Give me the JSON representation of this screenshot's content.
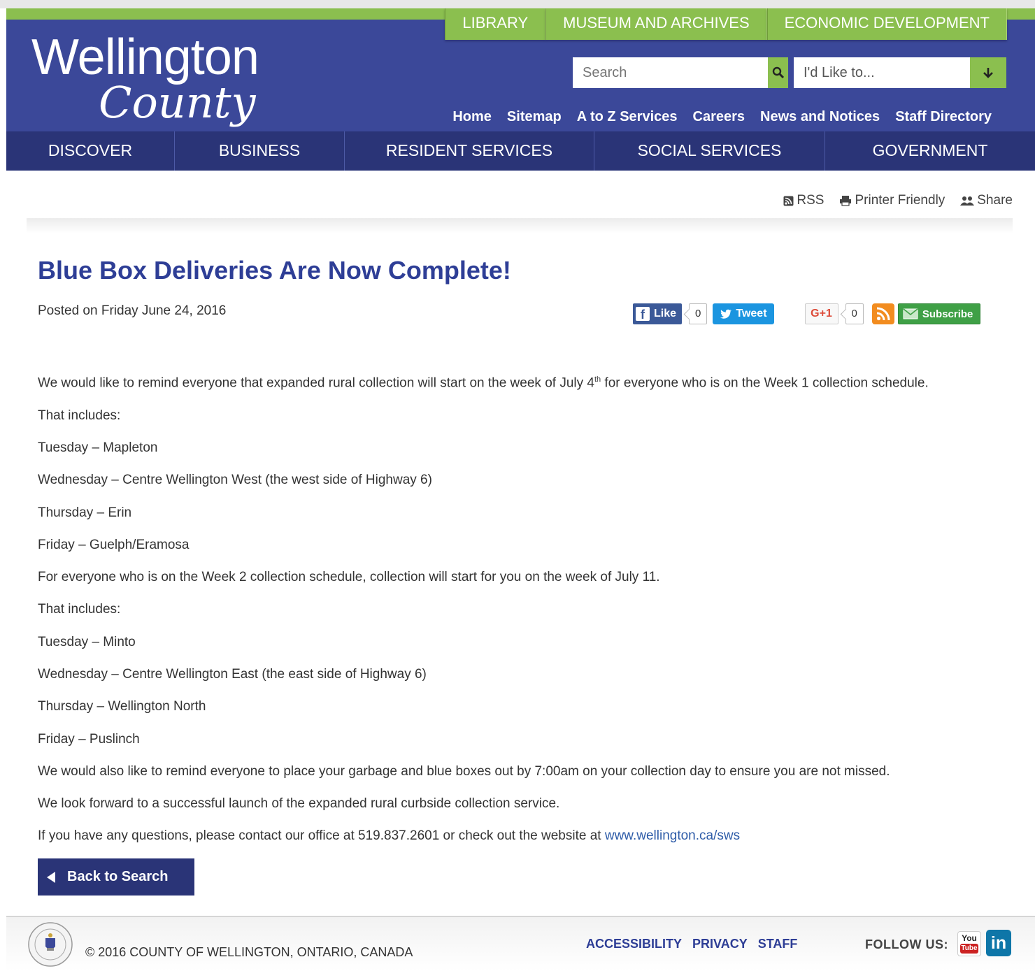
{
  "header": {
    "logo_line1": "Wellington",
    "logo_line2": "County",
    "green_tabs": [
      "LIBRARY",
      "MUSEUM AND ARCHIVES",
      "ECONOMIC DEVELOPMENT"
    ],
    "search_placeholder": "Search",
    "like_to": "I'd Like to...",
    "util_nav": [
      "Home",
      "Sitemap",
      "A to Z Services",
      "Careers",
      "News and Notices",
      "Staff Directory"
    ],
    "main_nav": [
      "DISCOVER",
      "BUSINESS",
      "RESIDENT SERVICES",
      "SOCIAL SERVICES",
      "GOVERNMENT"
    ]
  },
  "tools": {
    "rss": "RSS",
    "printer": "Printer Friendly",
    "share": "Share"
  },
  "article": {
    "title": "Blue Box Deliveries Are Now Complete!",
    "posted": "Posted on Friday June 24, 2016",
    "p1_before": "We would like to remind everyone that expanded rural collection will start on the week of July 4",
    "p1_sup": "th",
    "p1_after": " for everyone who is on the Week 1 collection schedule.",
    "lines": [
      "That includes:",
      "Tuesday – Mapleton",
      "Wednesday – Centre Wellington West (the west side of Highway 6)",
      "Thursday – Erin",
      "Friday – Guelph/Eramosa",
      "For everyone who is on the Week 2 collection schedule, collection will start for you on the week of July 11.",
      "That includes:",
      "Tuesday – Minto",
      "Wednesday – Centre Wellington East (the east side of Highway 6)",
      "Thursday – Wellington North",
      "Friday – Puslinch",
      "We would also like to remind everyone to place your garbage and blue boxes out by 7:00am on your collection day to ensure you are not missed.",
      "We look forward to a successful launch of the expanded rural curbside collection service."
    ],
    "contact_text": "If you have any questions, please contact our office at 519.837.2601 or check out the website at ",
    "contact_link": "www.wellington.ca/sws",
    "back_label": "Back to Search"
  },
  "social": {
    "like": "Like",
    "like_count": "0",
    "tweet": "Tweet",
    "gplus": "G+1",
    "gplus_count": "0",
    "subscribe": "Subscribe"
  },
  "footer": {
    "copyright": "© 2016 COUNTY OF WELLINGTON, ONTARIO, CANADA",
    "links": [
      "ACCESSIBILITY",
      "PRIVACY",
      "STAFF"
    ],
    "follow": "FOLLOW US:",
    "youtube_top": "You",
    "youtube_bottom": "Tube",
    "linkedin": "in"
  },
  "colors": {
    "header_blue": "#3b4899",
    "nav_blue": "#2a3477",
    "accent_green": "#8bbf4f",
    "title_blue": "#2e3e96"
  }
}
